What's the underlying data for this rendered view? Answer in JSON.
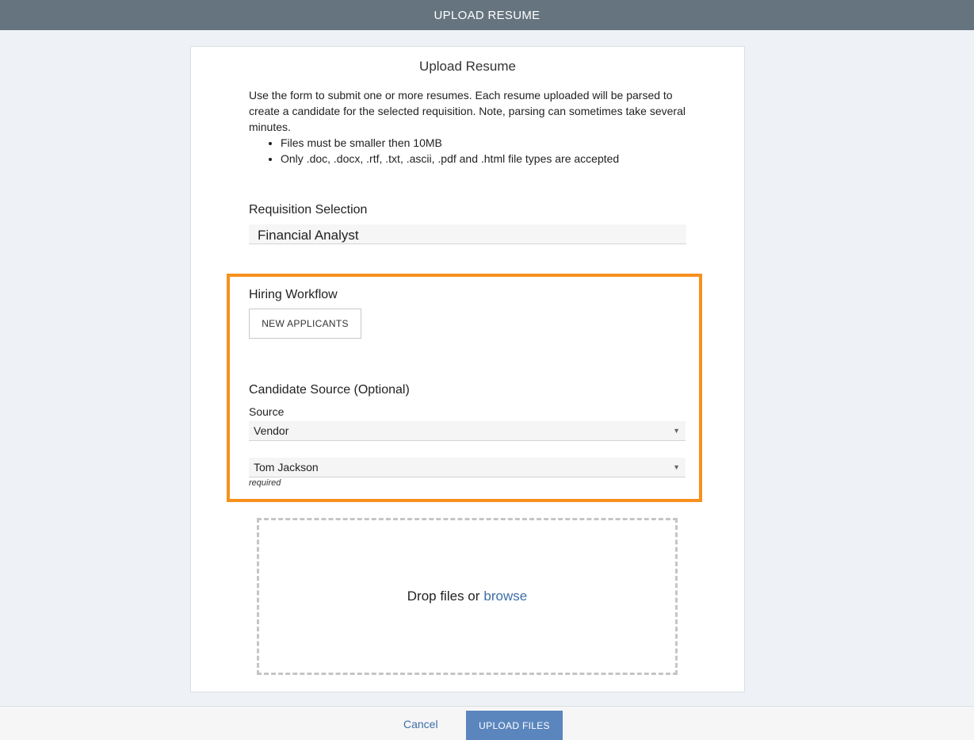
{
  "header": {
    "title": "UPLOAD RESUME"
  },
  "panel": {
    "title": "Upload Resume",
    "intro": "Use the form to submit one or more resumes. Each resume uploaded will be parsed to create a candidate for the selected requisition. Note, parsing can sometimes take several minutes.",
    "rules": [
      "Files must be smaller then 10MB",
      "Only .doc, .docx, .rtf, .txt, .ascii, .pdf and .html file types are accepted"
    ]
  },
  "requisition": {
    "label": "Requisition Selection",
    "selected": "Financial Analyst"
  },
  "workflow": {
    "label": "Hiring Workflow",
    "button_label": "NEW APPLICANTS"
  },
  "candidate_source": {
    "label": "Candidate Source (Optional)",
    "source_label": "Source",
    "source_value": "Vendor",
    "vendor_value": "Tom Jackson",
    "required_note": "required"
  },
  "dropzone": {
    "text": "Drop files or",
    "browse_label": "browse"
  },
  "footer": {
    "cancel_label": "Cancel",
    "upload_label": "UPLOAD FILES"
  },
  "colors": {
    "highlight": "#f7901e",
    "topbar": "#65747e",
    "primary": "#5b86bd",
    "link": "#3d6fa8"
  },
  "icons": {
    "dropdown_caret": "caret-down-icon"
  }
}
